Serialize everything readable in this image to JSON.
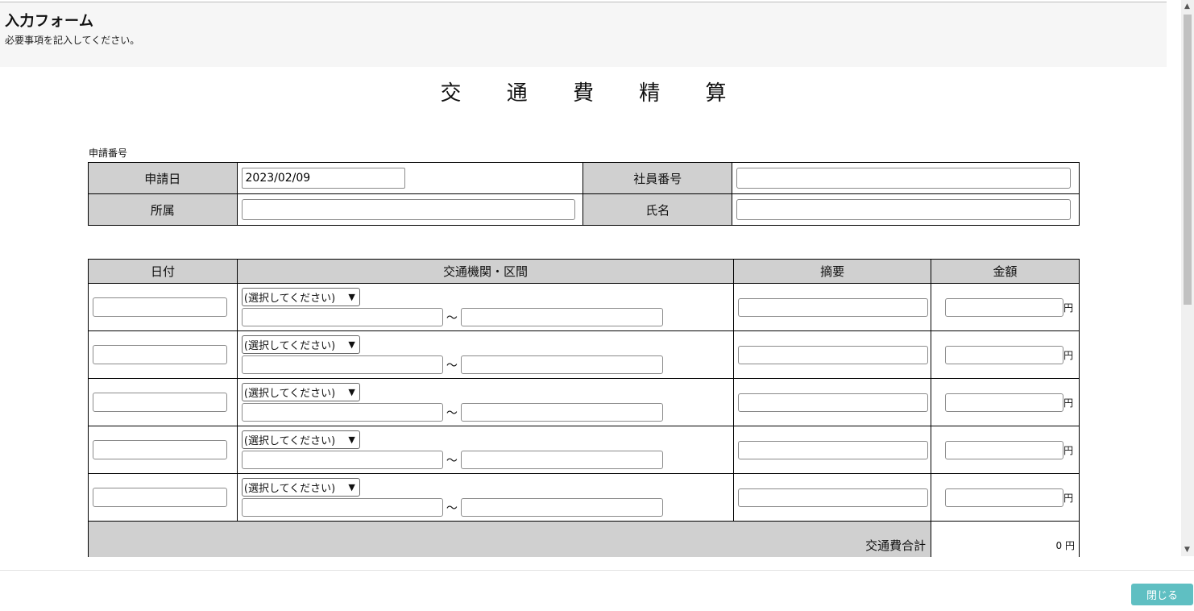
{
  "header": {
    "title": "入力フォーム",
    "subtitle": "必要事項を記入してください。"
  },
  "document": {
    "title": "交 通 費 精 算",
    "application_number_label": "申請番号"
  },
  "info": {
    "date_label": "申請日",
    "date_value": "2023/02/09",
    "employee_no_label": "社員番号",
    "employee_no_value": "",
    "department_label": "所属",
    "department_value": "",
    "name_label": "氏名",
    "name_value": ""
  },
  "transport_table": {
    "headers": {
      "date": "日付",
      "route": "交通機関・区間",
      "summary": "摘要",
      "amount": "金額"
    },
    "rows": [
      {
        "date": "",
        "method": "(選択してください)",
        "from": "",
        "tilde": "～",
        "to": "",
        "summary": "",
        "amount": "",
        "unit": "円"
      },
      {
        "date": "",
        "method": "(選択してください)",
        "from": "",
        "tilde": "～",
        "to": "",
        "summary": "",
        "amount": "",
        "unit": "円"
      },
      {
        "date": "",
        "method": "(選択してください)",
        "from": "",
        "tilde": "～",
        "to": "",
        "summary": "",
        "amount": "",
        "unit": "円"
      },
      {
        "date": "",
        "method": "(選択してください)",
        "from": "",
        "tilde": "～",
        "to": "",
        "summary": "",
        "amount": "",
        "unit": "円"
      },
      {
        "date": "",
        "method": "(選択してください)",
        "from": "",
        "tilde": "～",
        "to": "",
        "summary": "",
        "amount": "",
        "unit": "円"
      }
    ],
    "total_label": "交通費合計",
    "total_value": "0 円"
  },
  "footer": {
    "close_label": "閉じる"
  }
}
